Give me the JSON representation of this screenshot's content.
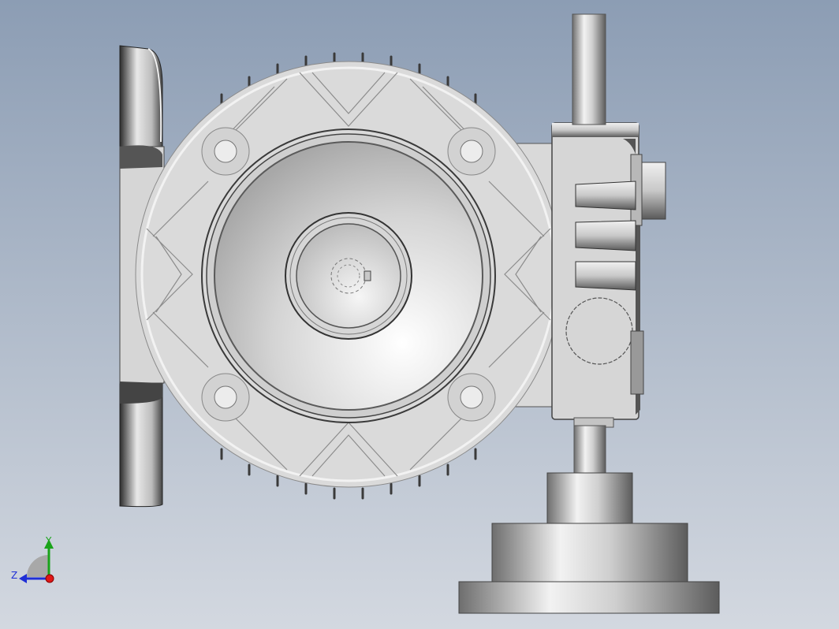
{
  "viewport": {
    "background_top": "#8c9db4",
    "background_bottom": "#d3d8e0"
  },
  "model": {
    "body_color": "#d8d8d8",
    "edge_color": "#3a3a3a",
    "highlight_color": "#f4f4f4",
    "shadow_color": "#7a7a7a"
  },
  "triad": {
    "y_label": "Y",
    "z_label": "Z",
    "y_color": "#1aa31a",
    "z_color": "#1f2fd6",
    "x_color": "#e01818"
  }
}
